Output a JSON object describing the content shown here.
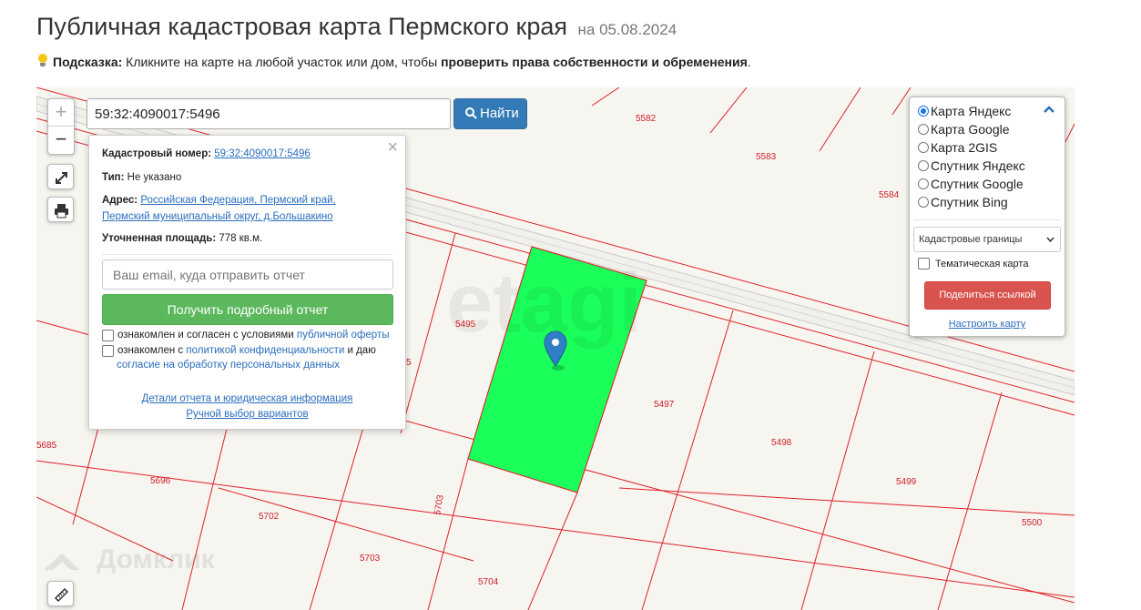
{
  "header": {
    "title": "Публичная кадастровая карта Пермского края",
    "date": "на 05.08.2024"
  },
  "hint": {
    "label": "Подсказка:",
    "text_before": " Кликните на карте на любой участок или дом, чтобы ",
    "text_bold": "проверить права собственности и обременения",
    "text_after": "."
  },
  "map": {
    "zoom_in": "+",
    "zoom_out": "−",
    "parcel_labels": [
      {
        "id": "lbl-5582",
        "text": "5582"
      },
      {
        "id": "lbl-5583",
        "text": "5583"
      },
      {
        "id": "lbl-5584",
        "text": "5584"
      },
      {
        "id": "lbl-5495",
        "text": "5495"
      },
      {
        "id": "lbl-5497",
        "text": "5497"
      },
      {
        "id": "lbl-5498",
        "text": "5498"
      },
      {
        "id": "lbl-5499",
        "text": "5499"
      },
      {
        "id": "lbl-5500",
        "text": "5500"
      },
      {
        "id": "lbl-5685",
        "text": "5685"
      },
      {
        "id": "lbl-5696",
        "text": "5696"
      },
      {
        "id": "lbl-5702",
        "text": "5702"
      },
      {
        "id": "lbl-5703a",
        "text": "5703"
      },
      {
        "id": "lbl-5703b",
        "text": "5703"
      },
      {
        "id": "lbl-5704",
        "text": "5704"
      },
      {
        "id": "lbl-5",
        "text": "5"
      }
    ],
    "watermark": "etagi",
    "watermark_bottom": "Домклик",
    "colors": {
      "parcel_highlight": "#1aff5a",
      "boundary": "#e0202a",
      "marker": "#2e7fc4"
    }
  },
  "search": {
    "value": "59:32:4090017:5496",
    "button_label": "Найти"
  },
  "info": {
    "cadastral_label": "Кадастровый номер:",
    "cadastral_value": "59:32:4090017:5496",
    "type_label": "Тип:",
    "type_value": "Не указано",
    "address_label": "Адрес:",
    "address_line1": "Российская Федерация, Пермский край,",
    "address_line2": "Пермский муниципальный округ, д.Большакино",
    "area_label": "Уточненная площадь:",
    "area_value": "778 кв.м.",
    "email_placeholder": "Ваш email, куда отправить отчет",
    "report_button": "Получить подробный отчет",
    "consent1_text": "ознакомлен и согласен с условиями ",
    "consent1_link": "публичной оферты",
    "consent2_text": "ознакомлен с ",
    "consent2_link": "политикой конфиденциальности",
    "consent2_tail": " и даю",
    "consent2_link2": "согласие на обработку персональных данных",
    "details_link": "Детали отчета и юридическая информация",
    "manual_link": "Ручной выбор вариантов",
    "close": "×"
  },
  "layers": {
    "options": [
      {
        "label": "Карта Яндекс",
        "checked": true
      },
      {
        "label": "Карта Google",
        "checked": false
      },
      {
        "label": "Карта 2GIS",
        "checked": false
      },
      {
        "label": "Спутник Яндекс",
        "checked": false
      },
      {
        "label": "Спутник Google",
        "checked": false
      },
      {
        "label": "Спутник Bing",
        "checked": false
      }
    ],
    "overlay_select": "Кадастровые границы",
    "thematic_label": "Тематическая карта",
    "share_button": "Поделиться ссылкой",
    "setup_link": "Настроить карту"
  }
}
